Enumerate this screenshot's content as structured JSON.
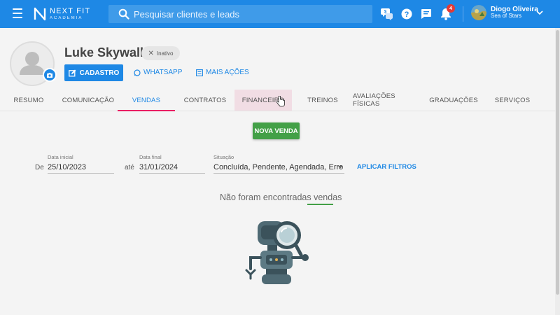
{
  "brand": {
    "name": "NEXT FIT",
    "sub": "ACADEMIA"
  },
  "search": {
    "placeholder": "Pesquisar clientes e leads"
  },
  "header": {
    "icons": [
      "chat-dollar-icon",
      "help-icon",
      "messages-icon",
      "notifications-icon"
    ],
    "notification_count": "4",
    "user": {
      "name": "Diogo Oliveira",
      "unit": "Sea of Stars"
    }
  },
  "profile": {
    "name": "Luke Skywalker",
    "status": "Inativo",
    "actions": {
      "cadastro": "CADASTRO",
      "whatsapp": "WHATSAPP",
      "mais": "MAIS AÇÕES"
    }
  },
  "tabs": [
    {
      "label": "RESUMO"
    },
    {
      "label": "COMUNICAÇÃO"
    },
    {
      "label": "VENDAS"
    },
    {
      "label": "CONTRATOS"
    },
    {
      "label": "FINANCEIRO"
    },
    {
      "label": "TREINOS"
    },
    {
      "label": "AVALIAÇÕES FÍSICAS"
    },
    {
      "label": "GRADUAÇÕES"
    },
    {
      "label": "SERVIÇOS"
    }
  ],
  "active_tab": "VENDAS",
  "main": {
    "new_sale": "NOVA VENDA",
    "filters": {
      "de": "De",
      "ate": "até",
      "start_label": "Data inicial",
      "start_value": "25/10/2023",
      "end_label": "Data final",
      "end_value": "31/01/2024",
      "status_label": "Situação",
      "status_value": "Concluída, Pendente, Agendada, Erro",
      "apply": "APLICAR FILTROS"
    },
    "empty_prefix": "Não foram encontradas ",
    "empty_highlight": "vendas"
  },
  "colors": {
    "primary": "#1e88e5",
    "success": "#43a047",
    "tab_indicator": "#e91e63",
    "badge": "#e53935"
  }
}
